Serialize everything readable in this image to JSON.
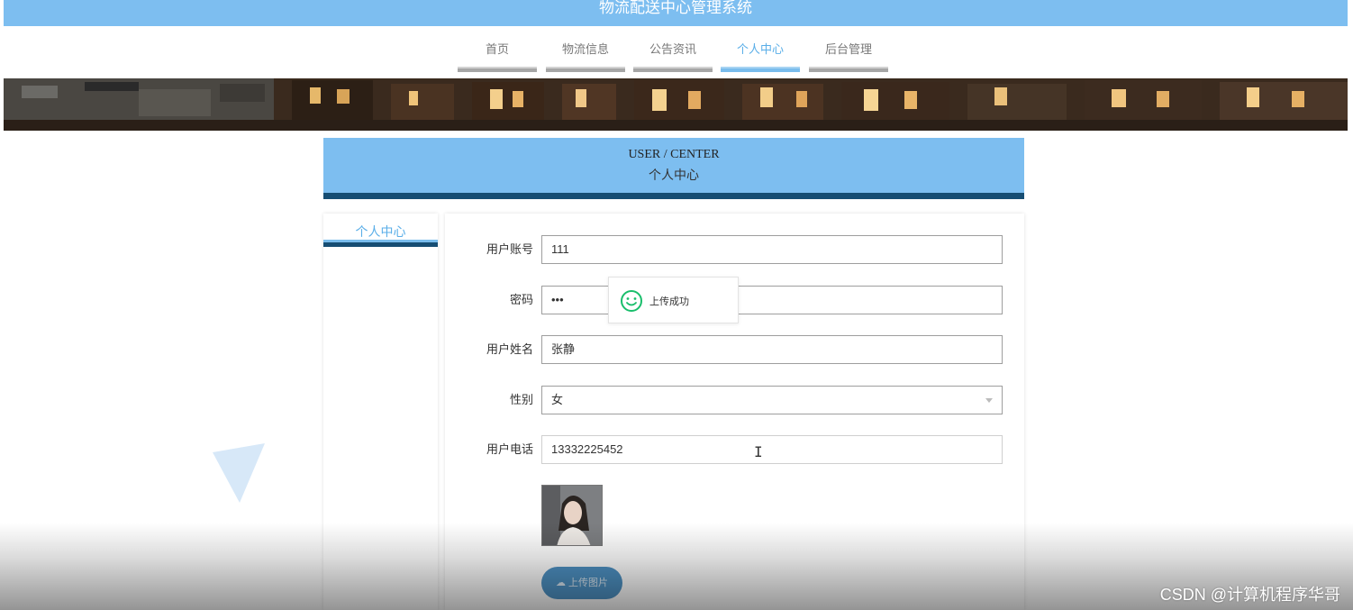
{
  "site": {
    "title": "物流配送中心管理系统"
  },
  "nav": {
    "items": [
      {
        "label": "首页"
      },
      {
        "label": "物流信息"
      },
      {
        "label": "公告资讯"
      },
      {
        "label": "个人中心",
        "active": true
      },
      {
        "label": "后台管理"
      }
    ]
  },
  "section": {
    "title_en": "USER / CENTER",
    "title_cn": "个人中心"
  },
  "sidebar": {
    "items": [
      {
        "label": "个人中心",
        "active": true
      }
    ]
  },
  "form": {
    "account": {
      "label": "用户账号",
      "value": "111"
    },
    "password": {
      "label": "密码",
      "value": "•••"
    },
    "name": {
      "label": "用户姓名",
      "value": "张静"
    },
    "gender": {
      "label": "性别",
      "value": "女"
    },
    "phone": {
      "label": "用户电话",
      "value": "13332225452"
    },
    "upload_button": {
      "label": "上传图片",
      "icon": "cloud-upload-icon"
    }
  },
  "toast": {
    "message": "上传成功",
    "icon": "smile-icon"
  },
  "watermark": "CSDN @计算机程序华哥",
  "colors": {
    "accent": "#7dbef0",
    "dark_accent": "#164d73",
    "button": "#4e92c4",
    "success": "#19be6b"
  }
}
